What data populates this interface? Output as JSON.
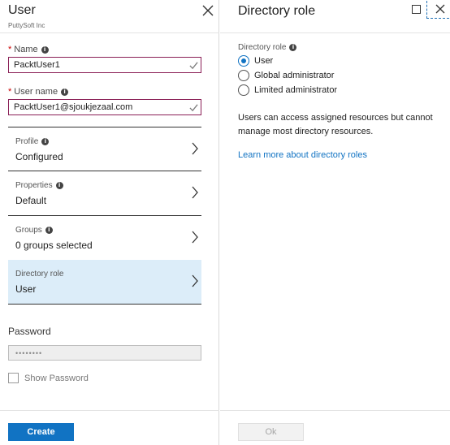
{
  "user_blade": {
    "title": "User",
    "subtitle": "PuttySoft Inc",
    "name": {
      "required_mark": "*",
      "label": "Name",
      "value": "PacktUser1"
    },
    "user_name": {
      "required_mark": "*",
      "label": "User name",
      "value": "PacktUser1@sjoukjezaal.com"
    },
    "nav_items": [
      {
        "label": "Profile",
        "value": "Configured"
      },
      {
        "label": "Properties",
        "value": "Default"
      },
      {
        "label": "Groups",
        "value": "0 groups selected"
      },
      {
        "label": "Directory role",
        "value": "User"
      }
    ],
    "password": {
      "label": "Password",
      "value": "••••••••"
    },
    "show_password_label": "Show Password",
    "create_label": "Create"
  },
  "role_blade": {
    "title": "Directory role",
    "field_label": "Directory role",
    "options": [
      {
        "label": "User",
        "selected": true
      },
      {
        "label": "Global administrator",
        "selected": false
      },
      {
        "label": "Limited administrator",
        "selected": false
      }
    ],
    "description": "Users can access assigned resources but cannot manage most directory resources.",
    "learn_more_link": "Learn more about directory roles",
    "ok_label": "Ok"
  },
  "colors": {
    "accent_blue": "#1173c3",
    "selected_row_bg": "#dcedf9",
    "input_border": "#8a1f56",
    "valid_check": "#7a7a7a"
  }
}
